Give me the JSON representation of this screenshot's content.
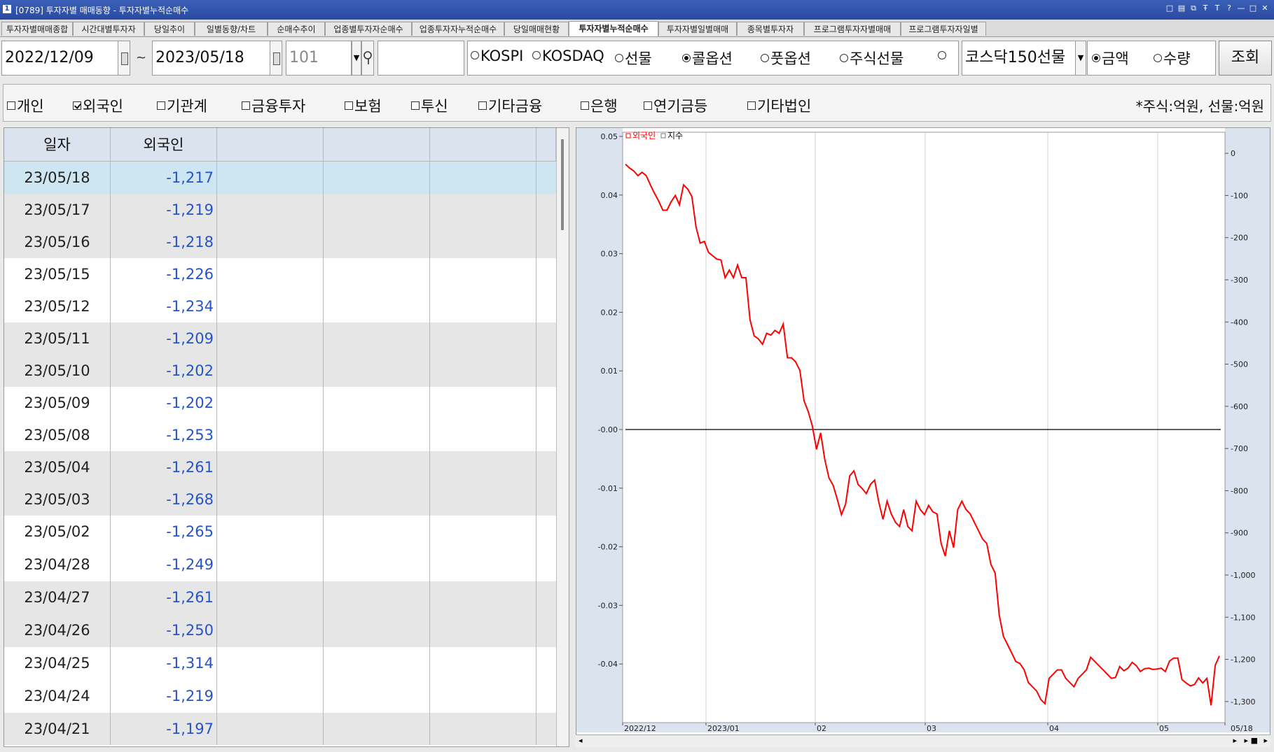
{
  "window": {
    "icon_label": "1",
    "title": "[0789] 투자자별 매매동향 - 투자자별누적순매수",
    "controls": [
      "□",
      "▤",
      "⧉",
      "Ŧ",
      "T",
      "?",
      "—",
      "□",
      "✕"
    ]
  },
  "tabs": [
    {
      "label": "투자자별매매종합"
    },
    {
      "label": "시간대별투자자"
    },
    {
      "label": "당일추이"
    },
    {
      "label": "일별동향/차트"
    },
    {
      "label": "순매수추이"
    },
    {
      "label": "업종별투자자순매수"
    },
    {
      "label": "업종투자자누적순매수"
    },
    {
      "label": "당일매매현황"
    },
    {
      "label": "투자자별누적순매수"
    },
    {
      "label": "투자자별일별매매"
    },
    {
      "label": "종목별투자자"
    },
    {
      "label": "프로그램투자자별매매"
    },
    {
      "label": "프로그램투자자일별"
    }
  ],
  "active_tab": 8,
  "controls": {
    "date_from": "2022/12/09",
    "tilde": "~",
    "date_to": "2023/05/18",
    "code": "101",
    "dropdown_arrow": "▼",
    "market_radios": [
      {
        "label": "KOSPI",
        "selected": false
      },
      {
        "label": "KOSDAQ",
        "selected": false
      },
      {
        "label": "선물",
        "selected": false
      },
      {
        "label": "콜옵션",
        "selected": true
      },
      {
        "label": "풋옵션",
        "selected": false
      },
      {
        "label": "주식선물",
        "selected": false
      },
      {
        "label": "",
        "selected": false
      }
    ],
    "product_select": "코스닥150선물",
    "unit_radios": [
      {
        "label": "금액",
        "selected": true
      },
      {
        "label": "수량",
        "selected": false
      }
    ],
    "query_button": "조회"
  },
  "investors": [
    {
      "label": "개인",
      "checked": false
    },
    {
      "label": "외국인",
      "checked": true
    },
    {
      "label": "기관계",
      "checked": false
    },
    {
      "label": "금융투자",
      "checked": false
    },
    {
      "label": "보험",
      "checked": false
    },
    {
      "label": "투신",
      "checked": false
    },
    {
      "label": "기타금융",
      "checked": false
    },
    {
      "label": "은행",
      "checked": false
    },
    {
      "label": "연기금등",
      "checked": false
    },
    {
      "label": "기타법인",
      "checked": false
    }
  ],
  "unit_note": "*주식:억원, 선물:억원",
  "grid": {
    "headers": [
      "일자",
      "외국인",
      "",
      "",
      "",
      ""
    ],
    "rows": [
      {
        "date": "23/05/18",
        "value": "-1,217"
      },
      {
        "date": "23/05/17",
        "value": "-1,219"
      },
      {
        "date": "23/05/16",
        "value": "-1,218"
      },
      {
        "date": "23/05/15",
        "value": "-1,226"
      },
      {
        "date": "23/05/12",
        "value": "-1,234"
      },
      {
        "date": "23/05/11",
        "value": "-1,209"
      },
      {
        "date": "23/05/10",
        "value": "-1,202"
      },
      {
        "date": "23/05/09",
        "value": "-1,202"
      },
      {
        "date": "23/05/08",
        "value": "-1,253"
      },
      {
        "date": "23/05/04",
        "value": "-1,261"
      },
      {
        "date": "23/05/03",
        "value": "-1,268"
      },
      {
        "date": "23/05/02",
        "value": "-1,265"
      },
      {
        "date": "23/04/28",
        "value": "-1,249"
      },
      {
        "date": "23/04/27",
        "value": "-1,261"
      },
      {
        "date": "23/04/26",
        "value": "-1,250"
      },
      {
        "date": "23/04/25",
        "value": "-1,314"
      },
      {
        "date": "23/04/24",
        "value": "-1,219"
      },
      {
        "date": "23/04/21",
        "value": "-1,197"
      }
    ]
  },
  "colors": {
    "series_foreign": "#ff0000",
    "series_index": "#000000",
    "value_text": "#2553c8",
    "selected_row": "#cde6f2",
    "alt_row": "#e6e6e6",
    "axis_panel": "#dbe3ee"
  },
  "chart_data": {
    "type": "line",
    "legend": [
      {
        "name": "외국인",
        "color": "#ff0000"
      },
      {
        "name": "지수",
        "color": "#000000"
      }
    ],
    "left_axis": {
      "min": -0.05,
      "max": 0.05,
      "ticks": [
        "0.05",
        "0.04",
        "0.03",
        "0.02",
        "0.01",
        "-0.00",
        "-0.01",
        "-0.02",
        "-0.03",
        "-0.04"
      ]
    },
    "right_axis": {
      "min": -1350,
      "max": 50,
      "ticks": [
        "0",
        "-100",
        "-200",
        "-300",
        "-400",
        "-500",
        "-600",
        "-700",
        "-800",
        "-900",
        "-1,000",
        "-1,100",
        "-1,200",
        "-1,300"
      ]
    },
    "x_ticks": [
      "2022/12",
      "2023/01",
      "02",
      "03",
      "04",
      "05",
      "05/18"
    ],
    "index_line": {
      "name": "지수",
      "value": 0
    },
    "series": [
      {
        "name": "외국인",
        "values": [
          -31,
          -40,
          -47,
          -58,
          -50,
          -58,
          -80,
          -100,
          -118,
          -140,
          -140,
          -120,
          -105,
          -127,
          -80,
          -90,
          -108,
          -180,
          -218,
          -214,
          -240,
          -248,
          -256,
          -258,
          -300,
          -282,
          -300,
          -270,
          -300,
          -300,
          -400,
          -438,
          -445,
          -458,
          -432,
          -436,
          -425,
          -432,
          -410,
          -490,
          -490,
          -500,
          -520,
          -592,
          -617,
          -652,
          -707,
          -668,
          -731,
          -775,
          -792,
          -825,
          -862,
          -837,
          -770,
          -758,
          -790,
          -800,
          -812,
          -790,
          -780,
          -832,
          -873,
          -830,
          -860,
          -880,
          -890,
          -850,
          -890,
          -900,
          -830,
          -850,
          -862,
          -840,
          -855,
          -860,
          -930,
          -960,
          -900,
          -940,
          -850,
          -830,
          -850,
          -860,
          -880,
          -900,
          -920,
          -930,
          -980,
          -1000,
          -1100,
          -1150,
          -1170,
          -1190,
          -1210,
          -1215,
          -1230,
          -1260,
          -1270,
          -1280,
          -1300,
          -1310,
          -1250,
          -1240,
          -1230,
          -1230,
          -1250,
          -1260,
          -1270,
          -1250,
          -1240,
          -1230,
          -1200,
          -1210,
          -1220,
          -1230,
          -1240,
          -1250,
          -1248,
          -1222,
          -1232,
          -1226,
          -1212,
          -1220,
          -1234,
          -1227,
          -1226,
          -1229,
          -1228,
          -1226,
          -1234,
          -1209,
          -1202,
          -1202,
          -1253,
          -1261,
          -1268,
          -1265,
          -1249,
          -1261,
          -1250,
          -1314,
          -1219,
          -1197
        ]
      }
    ]
  }
}
